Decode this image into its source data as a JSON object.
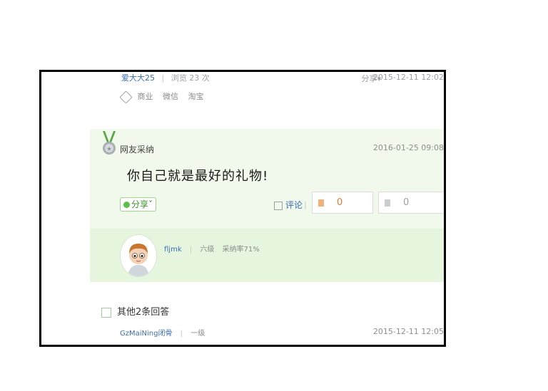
{
  "question": {
    "author": "爱大大25",
    "views": "浏览 23 次",
    "share_label": "分享",
    "date": "2015-12-11 12:02",
    "tags": [
      "商业",
      "微信",
      "淘宝"
    ]
  },
  "best_answer": {
    "label": "网友采纳",
    "date": "2016-01-25 09:08",
    "text": "你自己就是最好的礼物!",
    "share_label": "分享",
    "comment_label": "评论",
    "upvotes": "0",
    "downvotes": "0",
    "user": {
      "name": "fljmk",
      "level": "六级",
      "accept_rate": "采纳率71%"
    }
  },
  "other_answers": {
    "title": "其他2条回答",
    "first": {
      "user": "GzMaiNing闭骨",
      "level": "一级",
      "date": "2015-12-11 12:05"
    }
  },
  "colors": {
    "accent_green": "#5cbf46",
    "link_blue": "#3b6db3",
    "best_bg": "#f0f9ec"
  }
}
